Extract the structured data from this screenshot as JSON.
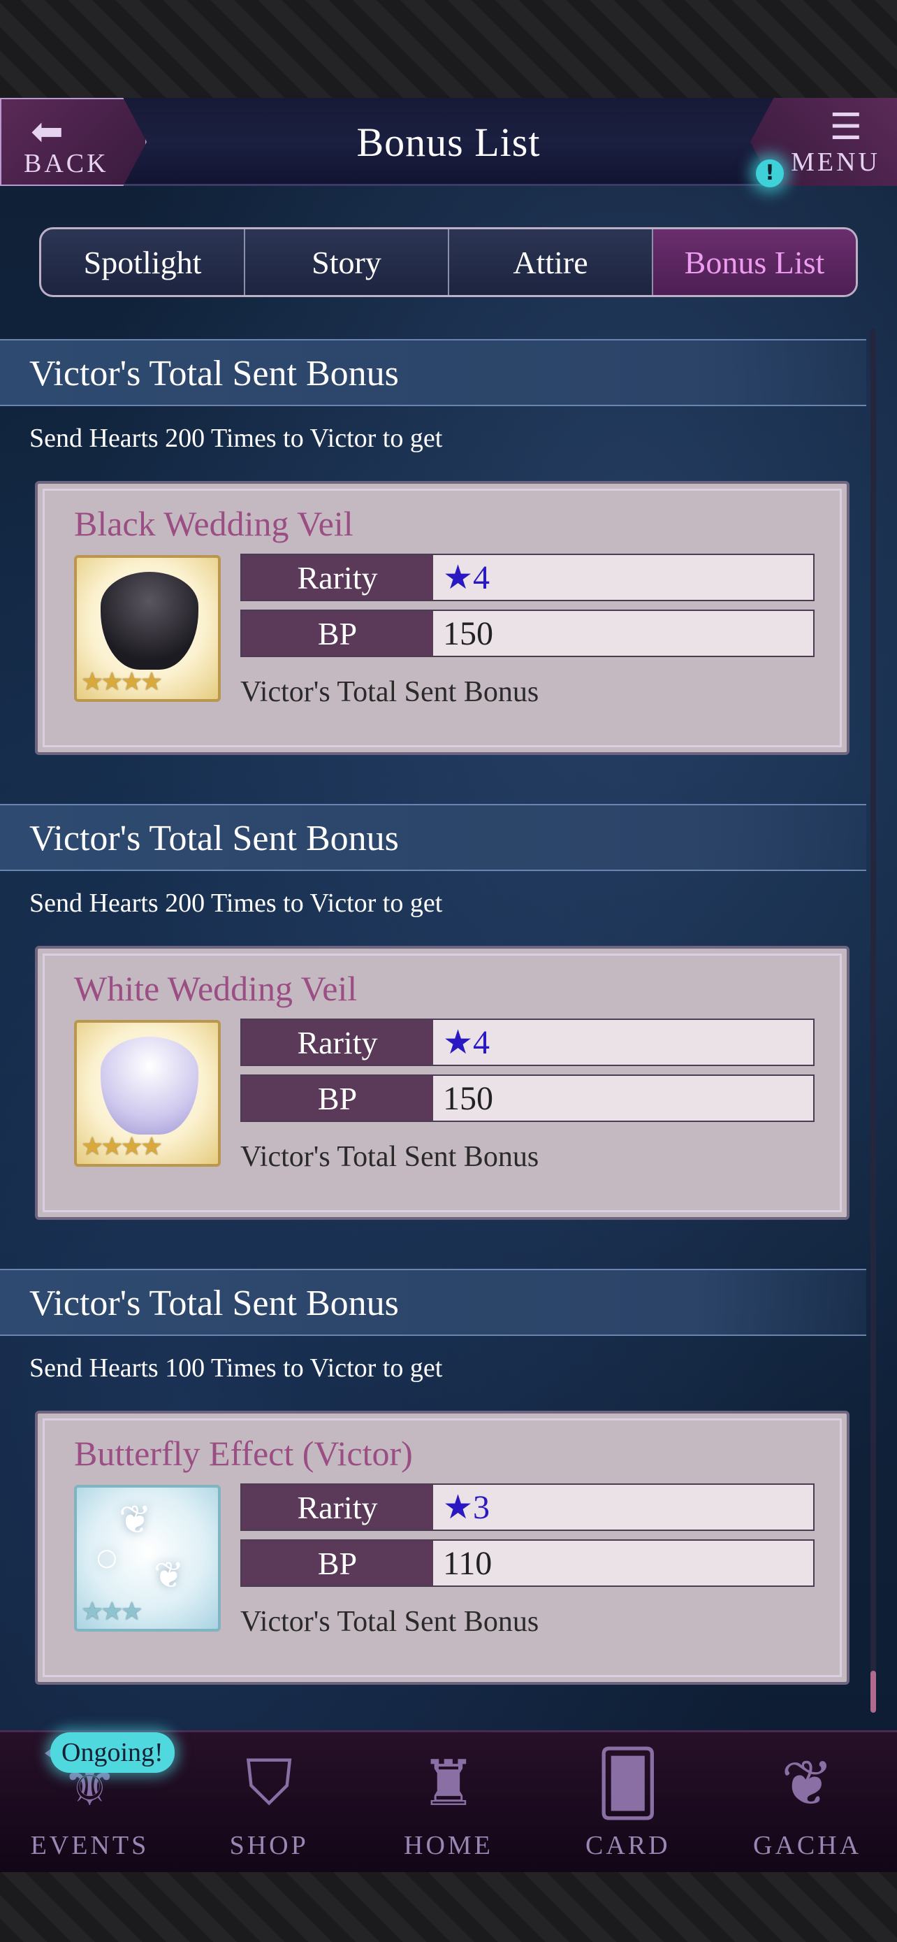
{
  "header": {
    "title": "Bonus List",
    "back_label": "BACK",
    "menu_label": "MENU",
    "menu_alert": "!"
  },
  "tabs": [
    {
      "label": "Spotlight",
      "active": false
    },
    {
      "label": "Story",
      "active": false
    },
    {
      "label": "Attire",
      "active": false
    },
    {
      "label": "Bonus List",
      "active": true
    }
  ],
  "bonuses": [
    {
      "section_title": "Victor's Total Sent Bonus",
      "description": "Send Hearts 200 Times to Victor to get",
      "item_name": "Black Wedding Veil",
      "rarity_label": "Rarity",
      "rarity_value": "★4",
      "bp_label": "BP",
      "bp_value": "150",
      "bonus_name": "Victor's Total Sent Bonus",
      "thumb_stars": "★★★★"
    },
    {
      "section_title": "Victor's Total Sent Bonus",
      "description": "Send Hearts 200 Times to Victor to get",
      "item_name": "White Wedding Veil",
      "rarity_label": "Rarity",
      "rarity_value": "★4",
      "bp_label": "BP",
      "bp_value": "150",
      "bonus_name": "Victor's Total Sent Bonus",
      "thumb_stars": "★★★★"
    },
    {
      "section_title": "Victor's Total Sent Bonus",
      "description": "Send Hearts 100 Times to Victor to get",
      "item_name": "Butterfly Effect (Victor)",
      "rarity_label": "Rarity",
      "rarity_value": "★3",
      "bp_label": "BP",
      "bp_value": "110",
      "bonus_name": "Victor's Total Sent Bonus",
      "thumb_stars": "★★★"
    }
  ],
  "bottom_nav": {
    "ongoing_badge": "Ongoing!",
    "items": [
      {
        "label": "EVENTS",
        "icon": "events-icon"
      },
      {
        "label": "SHOP",
        "icon": "shop-icon"
      },
      {
        "label": "HOME",
        "icon": "castle-icon"
      },
      {
        "label": "CARD",
        "icon": "card-icon"
      },
      {
        "label": "GACHA",
        "icon": "butterfly-icon"
      }
    ]
  },
  "colors": {
    "active_tab_text": "#ee9cf0",
    "item_title": "#9a4e84",
    "rarity_star": "#2a19c2",
    "alert": "#3fd1d9"
  }
}
